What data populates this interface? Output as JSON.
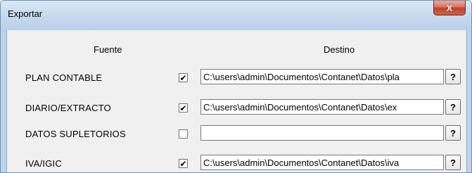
{
  "window": {
    "title": "Exportar",
    "close_label": "X"
  },
  "columns": {
    "source": "Fuente",
    "destination": "Destino"
  },
  "rows": [
    {
      "label": "PLAN CONTABLE",
      "checked": true,
      "check_mark": "✔",
      "path": "C:\\users\\admin\\Documentos\\Contanet\\Datos\\pla",
      "help_label": "?"
    },
    {
      "label": "DIARIO/EXTRACTO",
      "checked": true,
      "check_mark": "✔",
      "path": "C:\\users\\admin\\Documentos\\Contanet\\Datos\\ex",
      "help_label": "?"
    },
    {
      "label": "DATOS SUPLETORIOS",
      "checked": false,
      "check_mark": "",
      "path": "",
      "help_label": "?"
    },
    {
      "label": "IVA/IGIC",
      "checked": true,
      "check_mark": "✔",
      "path": "C:\\users\\admin\\Documentos\\Contanet\\Datos\\iva",
      "help_label": "?"
    }
  ]
}
